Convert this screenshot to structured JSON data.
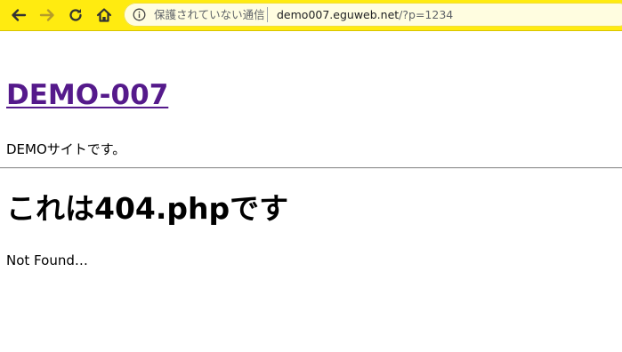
{
  "browser": {
    "toolbar_color": "#ffeb10",
    "icons": {
      "back": "arrow-left-icon",
      "forward": "arrow-right-icon",
      "reload": "reload-icon",
      "home": "home-icon",
      "info": "info-icon"
    },
    "address_bar": {
      "security_label": "保護されていない通信",
      "url_host": "demo007.eguweb.net",
      "url_path": "/?p=1234"
    }
  },
  "page": {
    "site_title": "DEMO-007",
    "site_description": "DEMOサイトです。",
    "heading": "これは404.phpです",
    "body_text": "Not Found…",
    "link_color": "#551a8b"
  }
}
